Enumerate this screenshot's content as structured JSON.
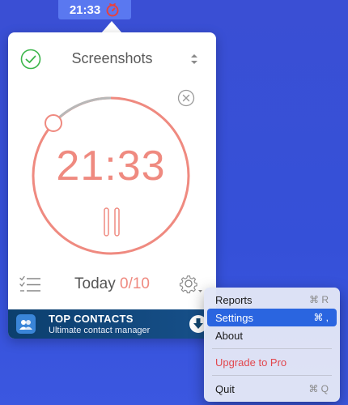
{
  "menubar": {
    "time": "21:33",
    "icon": "tomato-timer-icon"
  },
  "popover": {
    "project_name": "Screenshots",
    "timer": "21:33",
    "today_label": "Today",
    "today_count": "0/10",
    "icons": {
      "status": "check-circle-icon",
      "switch": "stepper-icon",
      "reset": "close-circle-icon",
      "pause": "pause-icon",
      "tasks": "task-list-icon",
      "settings": "gear-icon"
    },
    "colors": {
      "accent": "#ef8a80",
      "check": "#3bb54a",
      "ring_progress": "#b8b8b8"
    }
  },
  "ad": {
    "title": "TOP CONTACTS",
    "subtitle": "Ultimate contact manager",
    "icons": {
      "app": "contacts-app-icon",
      "download": "download-icon"
    }
  },
  "context_menu": {
    "items": [
      {
        "label": "Reports",
        "shortcut": "⌘ R"
      },
      {
        "label": "Settings",
        "shortcut": "⌘ ,"
      },
      {
        "label": "About",
        "shortcut": ""
      },
      {
        "label": "Upgrade to Pro",
        "shortcut": ""
      },
      {
        "label": "Quit",
        "shortcut": "⌘ Q"
      }
    ],
    "highlighted": "Settings"
  }
}
